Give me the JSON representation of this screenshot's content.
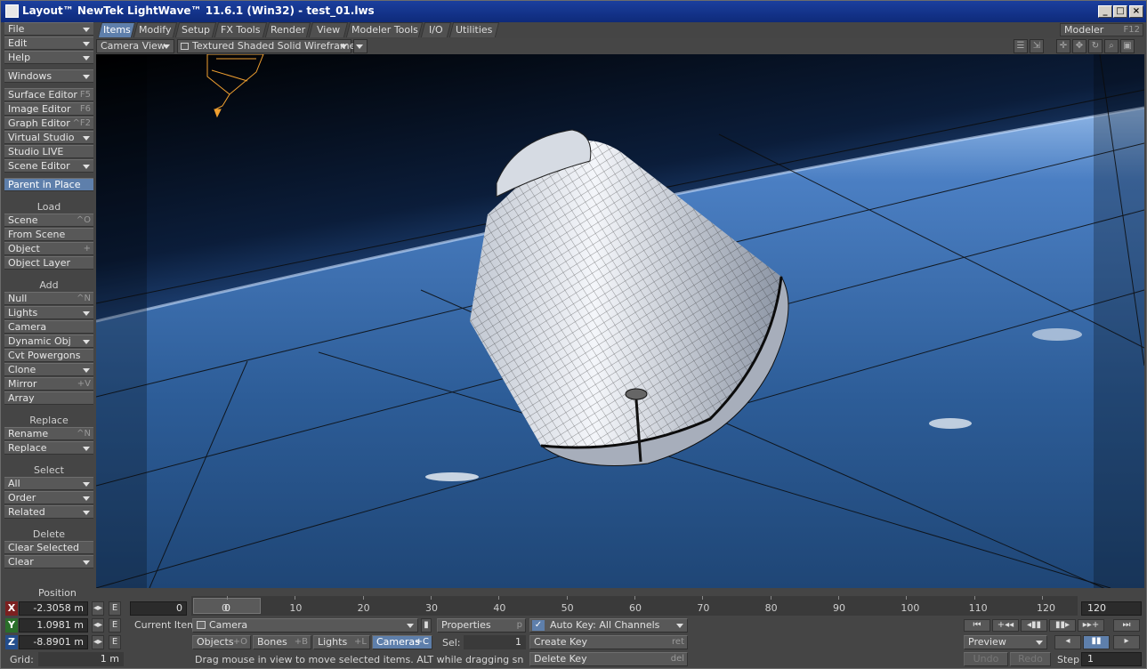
{
  "window": {
    "title": "Layout™ NewTek LightWave™ 11.6.1 (Win32) - test_01.lws"
  },
  "menu": [
    {
      "label": "File"
    },
    {
      "label": "Edit"
    },
    {
      "label": "Help"
    }
  ],
  "sidebar": {
    "windows": "Windows",
    "editors": [
      {
        "label": "Surface Editor",
        "key": "F5"
      },
      {
        "label": "Image Editor",
        "key": "F6"
      },
      {
        "label": "Graph Editor",
        "key": "^F2"
      },
      {
        "label": "Virtual Studio",
        "key": ""
      },
      {
        "label": "Studio LIVE",
        "key": ""
      },
      {
        "label": "Scene Editor",
        "key": ""
      }
    ],
    "parent_in_place": "Parent in Place",
    "load_header": "Load",
    "load": [
      {
        "label": "Scene",
        "key": "^O"
      },
      {
        "label": "From Scene",
        "key": ""
      },
      {
        "label": "Object",
        "key": "+"
      },
      {
        "label": "Object Layer",
        "key": ""
      }
    ],
    "add_header": "Add",
    "add": [
      {
        "label": "Null",
        "key": "^N"
      },
      {
        "label": "Lights",
        "key": ""
      },
      {
        "label": "Camera",
        "key": ""
      },
      {
        "label": "Dynamic Obj",
        "key": ""
      },
      {
        "label": "Cvt Powergons",
        "key": ""
      },
      {
        "label": "Clone",
        "key": ""
      },
      {
        "label": "Mirror",
        "key": "+V"
      },
      {
        "label": "Array",
        "key": ""
      }
    ],
    "replace_header": "Replace",
    "replace": [
      {
        "label": "Rename",
        "key": "^N"
      },
      {
        "label": "Replace",
        "key": ""
      }
    ],
    "select_header": "Select",
    "select": [
      {
        "label": "All"
      },
      {
        "label": "Order"
      },
      {
        "label": "Related"
      }
    ],
    "delete_header": "Delete",
    "delete": [
      {
        "label": "Clear Selected"
      },
      {
        "label": "Clear"
      }
    ]
  },
  "tabs": [
    {
      "label": "Items"
    },
    {
      "label": "Modify"
    },
    {
      "label": "Setup"
    },
    {
      "label": "FX Tools"
    },
    {
      "label": "Render"
    },
    {
      "label": "View"
    },
    {
      "label": "Modeler Tools"
    },
    {
      "label": "I/O"
    },
    {
      "label": "Utilities"
    }
  ],
  "modeler": {
    "label": "Modeler",
    "key": "F12"
  },
  "viewport": {
    "view_mode": "Camera View",
    "render_style": "Textured Shaded Solid Wireframe"
  },
  "position": {
    "label": "Position",
    "x_axis": "X",
    "y_axis": "Y",
    "z_axis": "Z",
    "x": "-2.3058 m",
    "y": "1.0981 m",
    "z": "-8.8901 m",
    "grid_label": "Grid:",
    "grid": "1 m",
    "e": "E"
  },
  "timeline": {
    "start": "0",
    "end": "120",
    "current": "0",
    "ticks": [
      "0",
      "10",
      "20",
      "30",
      "40",
      "50",
      "60",
      "70",
      "80",
      "90",
      "100",
      "110",
      "120"
    ]
  },
  "current_item": {
    "label": "Current Item",
    "value": "Camera",
    "properties": "Properties",
    "properties_key": "p"
  },
  "filters": {
    "objects": "Objects",
    "objects_key": "+O",
    "bones": "Bones",
    "bones_key": "+B",
    "lights": "Lights",
    "lights_key": "+L",
    "cameras": "Cameras",
    "cameras_key": "+C"
  },
  "sel": {
    "label": "Sel:",
    "value": "1"
  },
  "status": "Drag mouse in view to move selected items. ALT while dragging snaps to ite",
  "keys": {
    "autokey": "Auto Key: All Channels",
    "create": "Create Key",
    "create_key": "ret",
    "delete": "Delete Key",
    "delete_key": "del"
  },
  "playback": {
    "preview": "Preview",
    "undo": "Undo",
    "redo": "Redo",
    "step_label": "Step",
    "step": "1"
  }
}
